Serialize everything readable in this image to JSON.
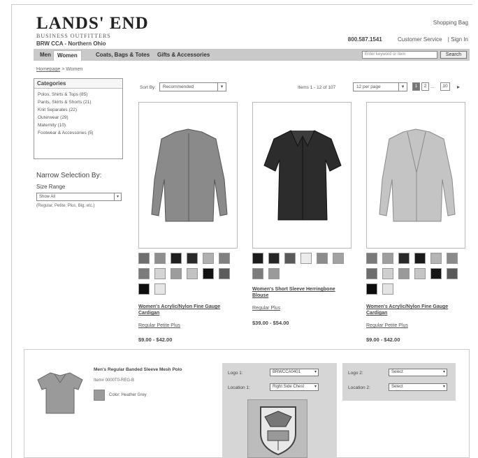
{
  "header": {
    "logo_main": "LANDS' END",
    "logo_sub": "BUSINESS OUTFITTERS",
    "account_name": "BRW CCA - Northern Ohio",
    "shopping_bag": "Shopping Bag",
    "phone": "800.587.1541",
    "customer_service": "Customer Service",
    "sign_in": "| Sign In"
  },
  "nav": {
    "tabs": [
      "Men",
      "Women",
      "Coats, Bags & Totes",
      "Gifts & Accessories"
    ],
    "active_tab": "Women",
    "search_placeholder": "Enter keyword or item",
    "search_button": "Search"
  },
  "breadcrumb": {
    "home": "Homepage",
    "current": "> Women"
  },
  "categories": {
    "title": "Categories",
    "items": [
      "Polos, Shirts & Tops (85)",
      "Pants, Skirts & Shorts (21)",
      "Knit Separates (22)",
      "Outerwear (29)",
      "Maternity (10)",
      "Footwear & Accessories (5)"
    ]
  },
  "narrow": {
    "title": "Narrow Selection By:",
    "size_label": "Size Range",
    "size_value": "Show All",
    "size_note": "(Regular, Petite, Plus, Big, etc.)"
  },
  "sort": {
    "label": "Sort By:",
    "value": "Recommended",
    "items_count": "Items 1 - 12 of 107",
    "per_page": "12 per page",
    "pages": [
      "1",
      "2"
    ],
    "last_page": "10",
    "ellipsis": "...",
    "next": "▸"
  },
  "products": [
    {
      "name": "Women's Acrylic/Nylon Fine Gauge Cardigan",
      "sizes": "Regular Petite Plus",
      "price": "$9.00 - $42.00",
      "garment_color": "#8a8a8a",
      "swatches": [
        "#6f6f6f",
        "#8e8e8e",
        "#1e1e1e",
        "#2a2a2a",
        "#b0b0b0",
        "#808080",
        "#7a7a7a",
        "#d4d4d4",
        "#9c9c9c",
        "#c2c2c2",
        "#111111",
        "#5c5c5c",
        "#0e0e0e",
        "#e6e6e6"
      ]
    },
    {
      "name": "Women's Short Sleeve Herringbone Blouse",
      "sizes": "Regular Plus",
      "price": "$39.00 - $54.00",
      "garment_color": "#2c2c2c",
      "swatches": [
        "#1c1c1c",
        "#262626",
        "#5a5a5a",
        "#ececec",
        "#8c8c8c",
        "#a2a2a2",
        "#7c7c7c",
        "#9a9a9a"
      ]
    },
    {
      "name": "Women's Acrylic/Nylon Fine Gauge Cardigan",
      "sizes": "Regular Petite Plus",
      "price": "$9.00 - $42.00",
      "garment_color": "#c4c4c4",
      "swatches": [
        "#7a7a7a",
        "#9e9e9e",
        "#2a2a2a",
        "#1a1a1a",
        "#b4b4b4",
        "#8a8a8a",
        "#6e6e6e",
        "#cfcfcf",
        "#9a9a9a",
        "#c6c6c6",
        "#141414",
        "#5a5a5a",
        "#0c0c0c",
        "#e4e4e4"
      ]
    }
  ],
  "customize": {
    "product_title": "Men's Regular Banded Sleeve Mesh Polo",
    "sku": "Item# 0000T0-REG-B",
    "color_label": "Color: Heather Grey",
    "logo1_label": "Logo 1:",
    "logo1_value": "BRWCCA0401",
    "location1_label": "Location 1:",
    "location1_value": "Right Side Chest",
    "logo2_label": "Logo 2:",
    "logo2_value": "Select",
    "location2_label": "Location 2:",
    "location2_value": "Select"
  }
}
